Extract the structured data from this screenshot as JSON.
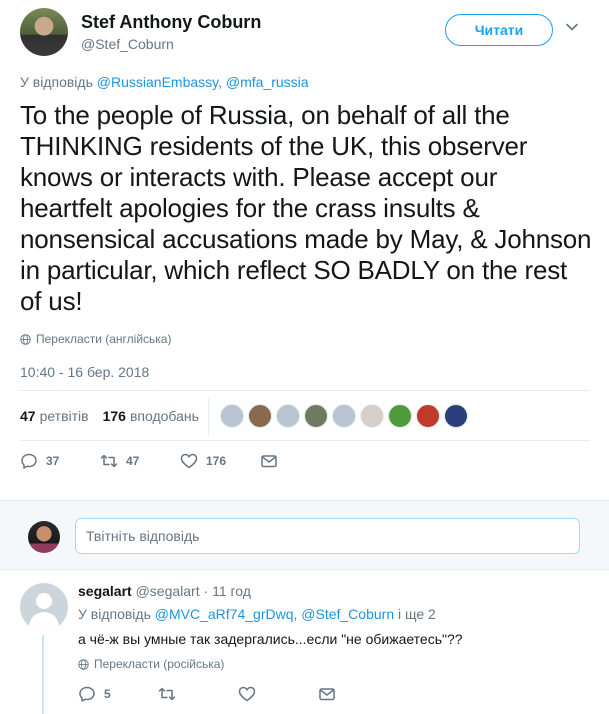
{
  "tweet": {
    "author_name": "Stef Anthony Coburn",
    "author_handle": "@Stef_Coburn",
    "follow_label": "Читати",
    "reply_prefix": "У відповідь",
    "reply_mention_1": "@RussianEmbassy",
    "reply_sep": ",",
    "reply_mention_2": "@mfa_russia",
    "text": "To the people of Russia, on behalf of all the THINKING residents of the UK, this observer knows or interacts with. Please accept our heartfelt apologies for the crass insults & nonsensical accusations made by May, & Johnson in particular, which reflect SO BADLY on the rest of us!",
    "translate_label": "Перекласти (англійська)",
    "timestamp": "10:40 - 16 бер. 2018",
    "retweets_count": "47",
    "retweets_label": "ретвітів",
    "likes_count": "176",
    "likes_label": "вподобань",
    "actions": {
      "reply_count": "37",
      "retweet_count": "47",
      "like_count": "176"
    }
  },
  "likers": [
    {
      "name": "liker-1",
      "color": "#b8c4cf"
    },
    {
      "name": "liker-2",
      "color": "#8a6a4f"
    },
    {
      "name": "liker-3",
      "color": "#b8c4cf"
    },
    {
      "name": "liker-4",
      "color": "#6f7a63"
    },
    {
      "name": "liker-5",
      "color": "#b8c4cf"
    },
    {
      "name": "liker-6",
      "color": "#d8d0c8"
    },
    {
      "name": "liker-7",
      "color": "#4f9a3a"
    },
    {
      "name": "liker-8",
      "color": "#c0392b"
    },
    {
      "name": "liker-9",
      "color": "#2c3e7a"
    }
  ],
  "reply_box": {
    "placeholder": "Твітніть відповідь"
  },
  "reply": {
    "name": "segalart",
    "handle": "@segalart",
    "time": "· 11 год",
    "reply_prefix": "У відповідь",
    "mention_1": "@MVC_aRf74_grDwq",
    "mention_2": "@Stef_Coburn",
    "and_more": "і ще 2",
    "text": "а чё-ж вы умные так задергались...если \"не обижаетесь\"??",
    "translate_label": "Перекласти (російська)",
    "reply_count": "5"
  },
  "colors": {
    "accent": "#1da1f2",
    "link": "#1b95e0",
    "muted": "#657786",
    "text": "#14171a"
  }
}
